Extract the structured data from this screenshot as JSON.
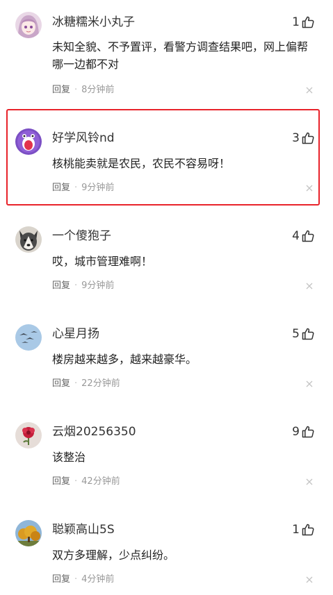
{
  "comments": [
    {
      "username": "冰糖糯米小丸子",
      "likes": "1",
      "text": "未知全貌、不予置评，看警方调查结果吧，网上偏帮哪一边都不对",
      "reply_label": "回复",
      "time": "8分钟前",
      "avatar_icon": "anime-girl-avatar"
    },
    {
      "username": "好学风铃nd",
      "likes": "3",
      "text": "核桃能卖就是农民，农民不容易呀！",
      "reply_label": "回复",
      "time": "9分钟前",
      "avatar_icon": "purple-monster-avatar"
    },
    {
      "username": "一个傻狍子",
      "likes": "4",
      "text": "哎，城市管理难啊！",
      "reply_label": "回复",
      "time": "9分钟前",
      "avatar_icon": "husky-dog-avatar"
    },
    {
      "username": "心星月扬",
      "likes": "5",
      "text": "楼房越来越多，越来越豪华。",
      "reply_label": "回复",
      "time": "22分钟前",
      "avatar_icon": "birds-sky-avatar"
    },
    {
      "username": "云烟20256350",
      "likes": "9",
      "text": "该整治",
      "reply_label": "回复",
      "time": "42分钟前",
      "avatar_icon": "red-flower-avatar"
    },
    {
      "username": "聪颖高山5S",
      "likes": "1",
      "text": "双方多理解，少点纠纷。",
      "reply_label": "回复",
      "time": "4分钟前",
      "avatar_icon": "autumn-tree-avatar"
    }
  ],
  "colors": {
    "highlight_border": "#e8222a",
    "meta_text": "#999999"
  }
}
